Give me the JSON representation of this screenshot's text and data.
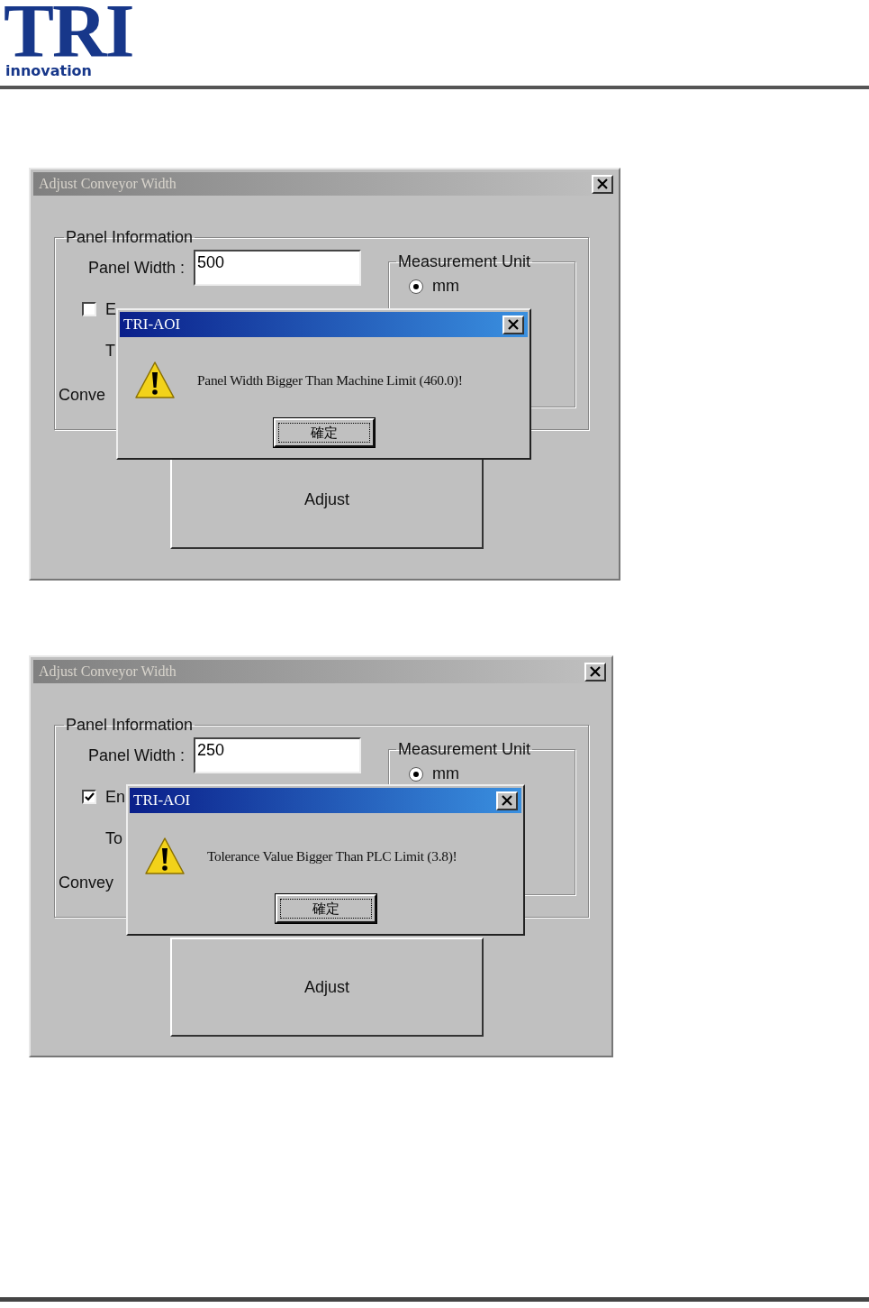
{
  "header": {
    "logo_text": "TRI",
    "logo_subtext": "innovation"
  },
  "screenshots": [
    {
      "window": {
        "title": "Adjust Conveyor Width"
      },
      "panel_group": {
        "title": "Panel Information",
        "panel_width_label": "Panel Width :",
        "panel_width_value": "500",
        "enable_checkbox": {
          "label": "E",
          "checked": false
        },
        "row_3_label": "T",
        "row_4_label": "Conve",
        "unit_group": {
          "title": "Measurement Unit",
          "options": [
            {
              "label": "mm",
              "selected": true
            }
          ]
        }
      },
      "adjust_button": "Adjust",
      "dialog": {
        "title": "TRI-AOI",
        "message": "Panel Width Bigger Than Machine Limit (460.0)!",
        "ok_button": "確定"
      }
    },
    {
      "window": {
        "title": "Adjust Conveyor Width"
      },
      "panel_group": {
        "title": "Panel Information",
        "panel_width_label": "Panel Width :",
        "panel_width_value": "250",
        "enable_checkbox": {
          "label": "En",
          "checked": true
        },
        "row_3_label": "To",
        "row_4_label": "Convey",
        "unit_group": {
          "title": "Measurement Unit",
          "options": [
            {
              "label": "mm",
              "selected": true
            }
          ]
        }
      },
      "adjust_button": "Adjust",
      "dialog": {
        "title": "TRI-AOI",
        "message": "Tolerance Value Bigger Than PLC Limit (3.8)!",
        "ok_button": "確定"
      }
    }
  ]
}
